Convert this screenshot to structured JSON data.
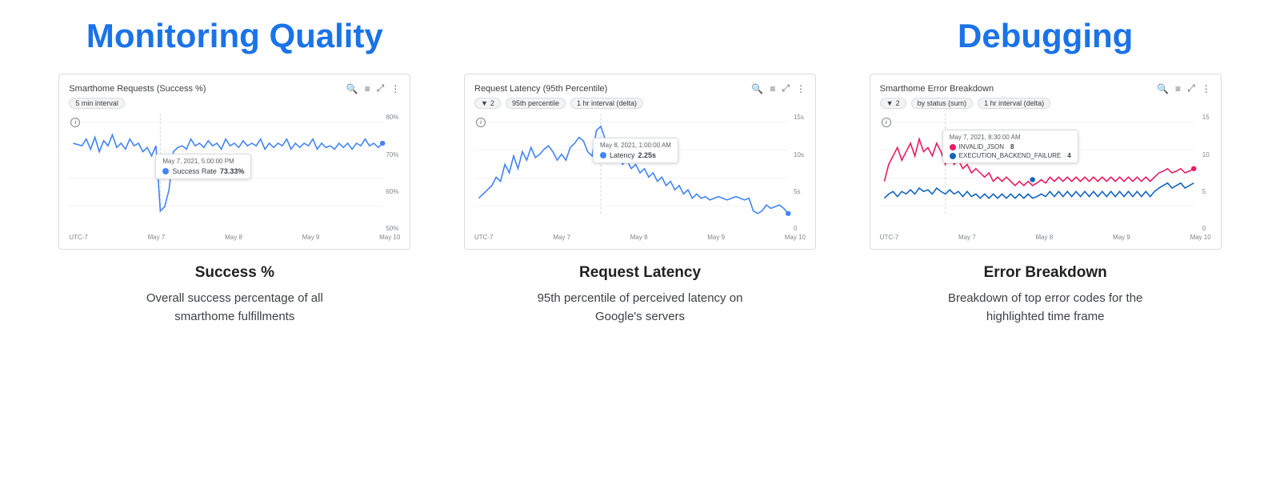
{
  "monitoring_section": {
    "title": "Monitoring Quality",
    "charts": [
      {
        "id": "success-rate",
        "title": "Smarthome Requests (Success %)",
        "filters": [
          "5 min interval"
        ],
        "subtitle": "Success %",
        "description": "Overall success percentage of all smarthome fulfillments",
        "tooltip": {
          "date": "May 7, 2021, 5:00:00 PM",
          "metric": "Success Rate",
          "value": "73.33%"
        },
        "y_axis": [
          "80%",
          "70%",
          "60%",
          "50%"
        ],
        "x_axis": [
          "UTC-7",
          "May 7",
          "May 8",
          "May 9",
          "May 10"
        ],
        "color": "#4285f4"
      },
      {
        "id": "request-latency",
        "title": "Request Latency (95th Percentile)",
        "filters": [
          "2",
          "95th percentile",
          "1 hr interval (delta)"
        ],
        "subtitle": "Request Latency",
        "description": "95th percentile of perceived latency on Google's servers",
        "tooltip": {
          "date": "May 8, 2021, 1:00:00 AM",
          "metric": "Latency",
          "value": "2.25s"
        },
        "y_axis": [
          "15s",
          "10s",
          "5s",
          "0"
        ],
        "x_axis": [
          "UTC-7",
          "May 7",
          "May 8",
          "May 9",
          "May 10"
        ],
        "color": "#4285f4"
      }
    ]
  },
  "debugging_section": {
    "title": "Debugging",
    "charts": [
      {
        "id": "error-breakdown",
        "title": "Smarthome Error Breakdown",
        "filters": [
          "2",
          "by status (sum)",
          "1 hr interval (delta)"
        ],
        "subtitle": "Error Breakdown",
        "description": "Breakdown of top error codes for the highlighted time frame",
        "tooltip": {
          "date": "May 7, 2021, 8:30:00 AM",
          "metrics": [
            {
              "label": "INVALID_JSON",
              "value": "8",
              "color": "#e91e63"
            },
            {
              "label": "EXECUTION_BACKEND_FAILURE",
              "value": "4",
              "color": "#1565c0"
            }
          ]
        },
        "y_axis": [
          "15",
          "10",
          "5",
          "0"
        ],
        "x_axis": [
          "UTC-7",
          "May 7",
          "May 8",
          "May 9",
          "May 10"
        ],
        "color": "#e91e63"
      }
    ]
  },
  "icons": {
    "search": "🔍",
    "filter": "≡",
    "expand": "⤢",
    "more": "⋮",
    "funnel": "▼"
  }
}
